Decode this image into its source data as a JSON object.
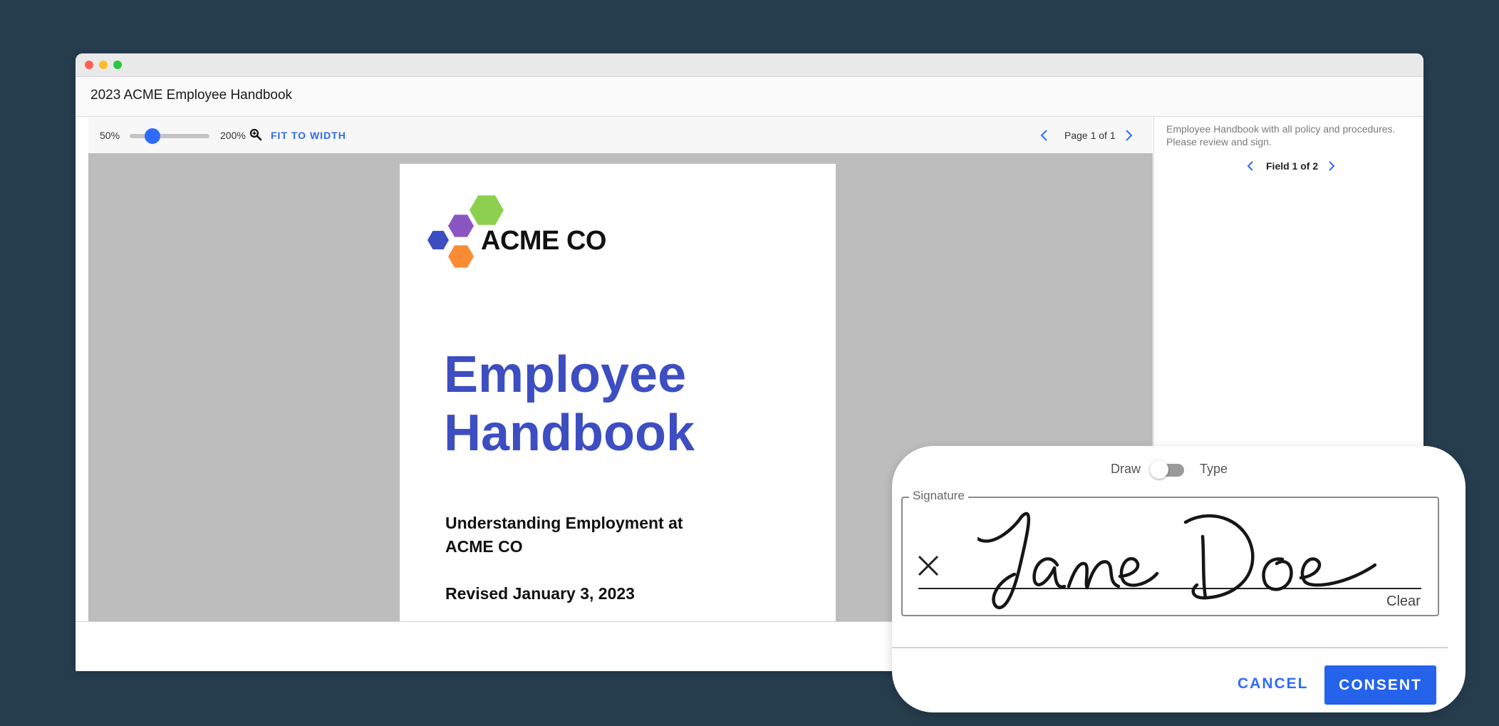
{
  "document": {
    "title": "2023 ACME Employee Handbook"
  },
  "toolbar": {
    "zoom_min": "50%",
    "zoom_max": "200%",
    "zoom_level": 0.29,
    "fit_label": "FIT TO WIDTH",
    "page_indicator": "Page 1 of 1"
  },
  "page": {
    "logo_text": "ACME CO",
    "title_line1": "Employee",
    "title_line2": "Handbook",
    "subtitle": "Understanding Employment at ACME CO",
    "revised": "Revised January 3, 2023",
    "logo_colors": {
      "green": "#8dd04f",
      "purple": "#8a55c1",
      "blue": "#3d4dc2",
      "orange": "#f98b35"
    }
  },
  "panel": {
    "description": "Employee Handbook with all policy and procedures. Please review and sign.",
    "field_indicator": "Field 1 of 2"
  },
  "signature_modal": {
    "mode_draw": "Draw",
    "mode_type": "Type",
    "signature_label": "Signature",
    "signed_name": "Jane Doe",
    "clear_label": "Clear",
    "cancel_label": "CANCEL",
    "consent_label": "CONSENT"
  },
  "colors": {
    "accent": "#2f6bff",
    "background": "#263d4e",
    "heading": "#3d4dc2"
  },
  "icons": {
    "zoom": "magnifier-icon",
    "prev": "chevron-left-icon",
    "next": "chevron-right-icon",
    "sign_marker": "x-mark-icon"
  }
}
